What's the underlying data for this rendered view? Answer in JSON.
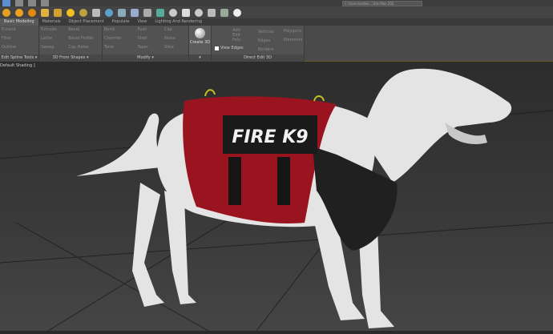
{
  "toolbar": {
    "path_field": "C:\\Users\\amber...\\3ds Max 202"
  },
  "tabs": [
    {
      "label": "Basic Modeling",
      "active": true
    },
    {
      "label": "Materials"
    },
    {
      "label": "Object Placement"
    },
    {
      "label": "Populate"
    },
    {
      "label": "View"
    },
    {
      "label": "Lighting And Rendering"
    }
  ],
  "ribbon": {
    "groups": [
      {
        "label": "Edit Spline Tools ▾",
        "items": [
          "Extend",
          "Fillet",
          "Outline"
        ]
      },
      {
        "label": "3D From Shapes ▾",
        "items": [
          "Extrude",
          "Lathe",
          "Sweep",
          "Bevel",
          "Bevel Profile",
          "Cap Holes"
        ]
      },
      {
        "label": "Modify ▾",
        "items": [
          "Bend",
          "Chamfer",
          "Twist",
          "Push",
          "Shell",
          "Taper",
          "Cap",
          "Noise",
          "Slice"
        ]
      },
      {
        "label": "▾",
        "items": [
          "Create 3D"
        ]
      },
      {
        "label": "Direct Edit 3D",
        "items": [
          "Add Edit Poly",
          "View Edges",
          "Vertices",
          "Edges",
          "Borders",
          "Polygons",
          "Elements"
        ]
      }
    ]
  },
  "viewport": {
    "label": "Default Shading ]",
    "patch_text": "FIRE K9",
    "colors": {
      "vest": "#9a1420",
      "dog": "#e6e6e6",
      "patch": "#1a1a1a"
    }
  }
}
